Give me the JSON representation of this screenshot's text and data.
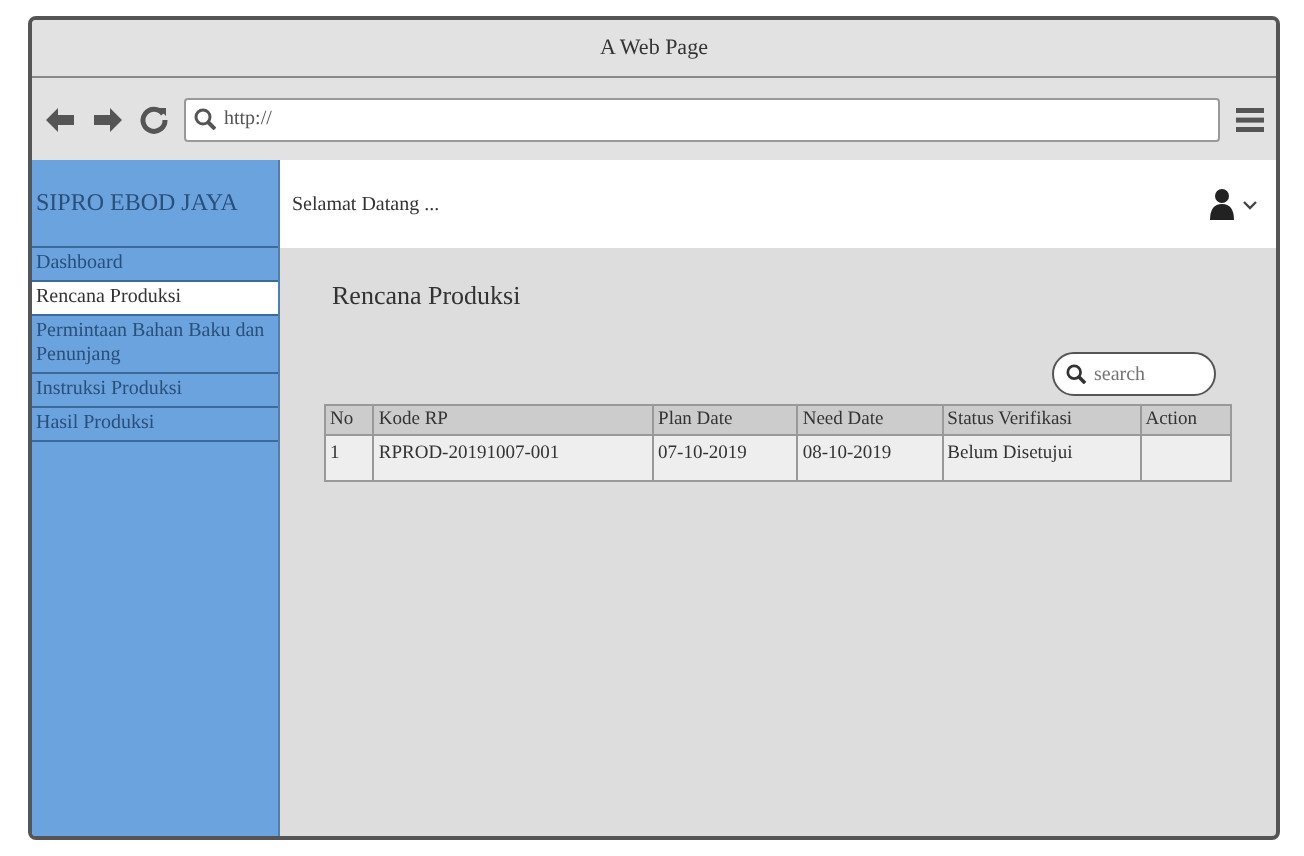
{
  "window": {
    "title": "A Web Page"
  },
  "browser": {
    "url": "http://"
  },
  "app": {
    "brand": "SIPRO EBOD JAYA",
    "greeting": "Selamat Datang ..."
  },
  "sidebar": {
    "items": [
      {
        "label": "Dashboard",
        "selected": false
      },
      {
        "label": "Rencana Produksi",
        "selected": true
      },
      {
        "label": "Permintaan Bahan Baku dan Penunjang",
        "selected": false
      },
      {
        "label": "Instruksi Produksi",
        "selected": false
      },
      {
        "label": "Hasil Produksi",
        "selected": false
      }
    ]
  },
  "page": {
    "title": "Rencana Produksi",
    "search": {
      "placeholder": "search"
    }
  },
  "table": {
    "columns": [
      "No",
      "Kode RP",
      "Plan Date",
      "Need Date",
      "Status Verifikasi",
      "Action"
    ],
    "rows": [
      [
        "1",
        "RPROD-20191007-001",
        "07-10-2019",
        "08-10-2019",
        "Belum Disetujui",
        ""
      ]
    ]
  }
}
